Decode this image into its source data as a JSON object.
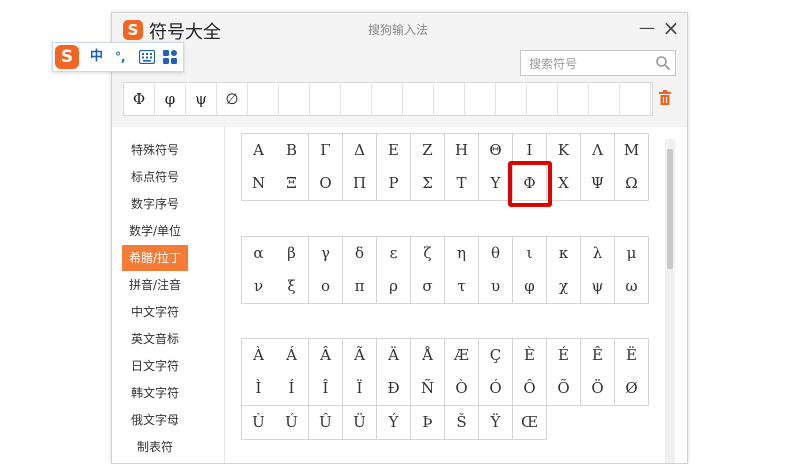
{
  "app": {
    "title": "符号大全",
    "center_title": "搜狗输入法",
    "close_glyph": "×",
    "minimize_glyph": "—",
    "logo_letter": "S"
  },
  "search": {
    "placeholder": "搜索符号",
    "value": ""
  },
  "recent": [
    "Φ",
    "φ",
    "ψ",
    "∅",
    "",
    "",
    "",
    "",
    "",
    "",
    "",
    "",
    "",
    "",
    "",
    "",
    ""
  ],
  "sidebar": {
    "items": [
      {
        "label": "特殊符号"
      },
      {
        "label": "标点符号"
      },
      {
        "label": "数字序号"
      },
      {
        "label": "数学/单位"
      },
      {
        "label": "希腊/拉丁"
      },
      {
        "label": "拼音/注音"
      },
      {
        "label": "中文字符"
      },
      {
        "label": "英文音标"
      },
      {
        "label": "日文字符"
      },
      {
        "label": "韩文字符"
      },
      {
        "label": "俄文字母"
      },
      {
        "label": "制表符"
      }
    ],
    "active_index": 4
  },
  "symbols": {
    "uppercase_greek": [
      "Α",
      "Β",
      "Γ",
      "Δ",
      "Ε",
      "Ζ",
      "Η",
      "Θ",
      "Ι",
      "Κ",
      "Λ",
      "Μ",
      "Ν",
      "Ξ",
      "Ο",
      "Π",
      "Ρ",
      "Σ",
      "Τ",
      "Υ",
      "Φ",
      "Χ",
      "Ψ",
      "Ω"
    ],
    "lowercase_greek": [
      "α",
      "β",
      "γ",
      "δ",
      "ε",
      "ζ",
      "η",
      "θ",
      "ι",
      "κ",
      "λ",
      "μ",
      "ν",
      "ξ",
      "ο",
      "π",
      "ρ",
      "σ",
      "τ",
      "υ",
      "φ",
      "χ",
      "ψ",
      "ω"
    ],
    "latin": [
      "À",
      "Á",
      "Â",
      "Ã",
      "Ä",
      "Å",
      "Æ",
      "Ç",
      "È",
      "É",
      "Ê",
      "Ë",
      "Ì",
      "Í",
      "Î",
      "Ï",
      "Ð",
      "Ñ",
      "Ò",
      "Ó",
      "Ô",
      "Õ",
      "Ö",
      "Ø",
      "Ù",
      "Ú",
      "Û",
      "Ü",
      "Ý",
      "Þ",
      "Š",
      "Ÿ",
      "Œ"
    ],
    "highlighted": "Φ"
  },
  "ime_bar": {
    "logo_letter": "S",
    "mode_label": "中",
    "punct_label": "°,"
  },
  "colors": {
    "accent": "#f57c36",
    "highlight": "#e00000",
    "logo": "#f26522"
  }
}
